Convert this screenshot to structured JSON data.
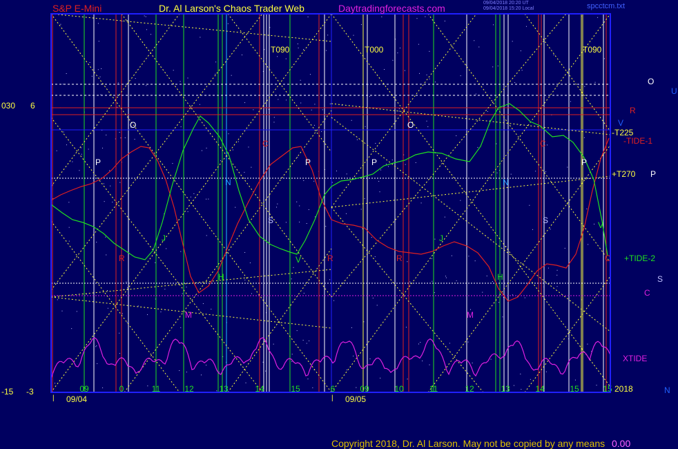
{
  "header": {
    "symbol": "S&P E-Mini",
    "title": "Dr. Al Larson's Chaos Trader Web",
    "site": "Daytradingforecasts.com",
    "stamp_line1": "09/04/2018 20:20 UT",
    "stamp_line2": "09/04/2018 15:20 Local",
    "file": "spcctcm.txt"
  },
  "footer": {
    "copyright": "Copyright 2018, Dr. Al Larson. May not be copied by any means",
    "tail": "0.00"
  },
  "colors": {
    "background": "#000060",
    "frame": "#2020ff",
    "price_green": "#20e020",
    "price_red": "#e02020",
    "xtide": "#e020e0",
    "grid_yellow": "#ffff40",
    "hour_line": "#ffffff"
  },
  "chart_data": {
    "type": "line",
    "title": "S&P E-Mini",
    "y_left_labels": [
      {
        "text": "030",
        "level": "upper"
      },
      {
        "text": "6",
        "level": "upper"
      },
      {
        "text": "-15",
        "level": "lower"
      },
      {
        "text": "-3",
        "level": "lower"
      }
    ],
    "x_hour_ticks": [
      {
        "label": "09",
        "color": "#20e020"
      },
      {
        "label": "0",
        "color": "#20e020"
      },
      {
        "label": "11",
        "color": "#20e020"
      },
      {
        "label": "12",
        "color": "#20e020"
      },
      {
        "label": "13",
        "color": "#20e020"
      },
      {
        "label": "14",
        "color": "#20e020"
      },
      {
        "label": "15",
        "color": "#20e020"
      },
      {
        "label": "6",
        "color": "#20e020"
      },
      {
        "label": "09",
        "color": "#20e020"
      },
      {
        "label": "10",
        "color": "#20e020"
      },
      {
        "label": "11",
        "color": "#20e020"
      },
      {
        "label": "12",
        "color": "#20e020"
      },
      {
        "label": "13",
        "color": "#20e020"
      },
      {
        "label": "14",
        "color": "#20e020"
      },
      {
        "label": "15",
        "color": "#20e020"
      },
      {
        "label": "15",
        "color": "#20e020"
      }
    ],
    "x_date_labels": [
      "09/04",
      "09/05"
    ],
    "year_label": "2018",
    "series": [
      {
        "name": "+TIDE-2",
        "color": "#20e020"
      },
      {
        "name": "-TIDE-1",
        "color": "#e02020"
      },
      {
        "name": "XTIDE",
        "color": "#e020e0"
      }
    ],
    "right_labels": [
      {
        "text": "O",
        "color": "#ffffff"
      },
      {
        "text": "U",
        "color": "#2060ff"
      },
      {
        "text": "R",
        "color": "#e02020"
      },
      {
        "text": "V",
        "color": "#2060ff"
      },
      {
        "text": "-T225",
        "color": "#ffff40"
      },
      {
        "text": "-TIDE-1",
        "color": "#e02020"
      },
      {
        "text": "+T270",
        "color": "#ffff40"
      },
      {
        "text": "P",
        "color": "#ffffff"
      },
      {
        "text": "+TIDE-2",
        "color": "#20e020"
      },
      {
        "text": "S",
        "color": "#c0c0ff"
      },
      {
        "text": "C",
        "color": "#e020e0"
      },
      {
        "text": "XTIDE",
        "color": "#e020e0"
      },
      {
        "text": "N",
        "color": "#2060ff"
      }
    ],
    "planet_markers": [
      {
        "text": "T090",
        "color": "#ffff40"
      },
      {
        "text": "T000",
        "color": "#ffff40"
      },
      {
        "text": "T090",
        "color": "#ffff40"
      },
      {
        "text": "O",
        "color": "#ffffff"
      },
      {
        "text": "O",
        "color": "#ffffff"
      },
      {
        "text": "P",
        "color": "#ffffff"
      },
      {
        "text": "P",
        "color": "#ffffff"
      },
      {
        "text": "P",
        "color": "#ffffff"
      },
      {
        "text": "P",
        "color": "#ffffff"
      },
      {
        "text": "N",
        "color": "#20a0ff"
      },
      {
        "text": "N",
        "color": "#20a0ff"
      },
      {
        "text": "S",
        "color": "#c0c0ff"
      },
      {
        "text": "S",
        "color": "#c0c0ff"
      },
      {
        "text": "J",
        "color": "#20e020"
      },
      {
        "text": "J",
        "color": "#20e020"
      },
      {
        "text": "H",
        "color": "#20e020"
      },
      {
        "text": "H",
        "color": "#20e020"
      },
      {
        "text": "M",
        "color": "#e020e0"
      },
      {
        "text": "M",
        "color": "#e020e0"
      },
      {
        "text": "R",
        "color": "#e02020"
      },
      {
        "text": "R",
        "color": "#e02020"
      },
      {
        "text": "R",
        "color": "#e02020"
      },
      {
        "text": "C",
        "color": "#e02020"
      },
      {
        "text": "C",
        "color": "#e02020"
      },
      {
        "text": "C",
        "color": "#e02020"
      },
      {
        "text": "V",
        "color": "#20e020"
      },
      {
        "text": "V",
        "color": "#20e020"
      }
    ]
  }
}
